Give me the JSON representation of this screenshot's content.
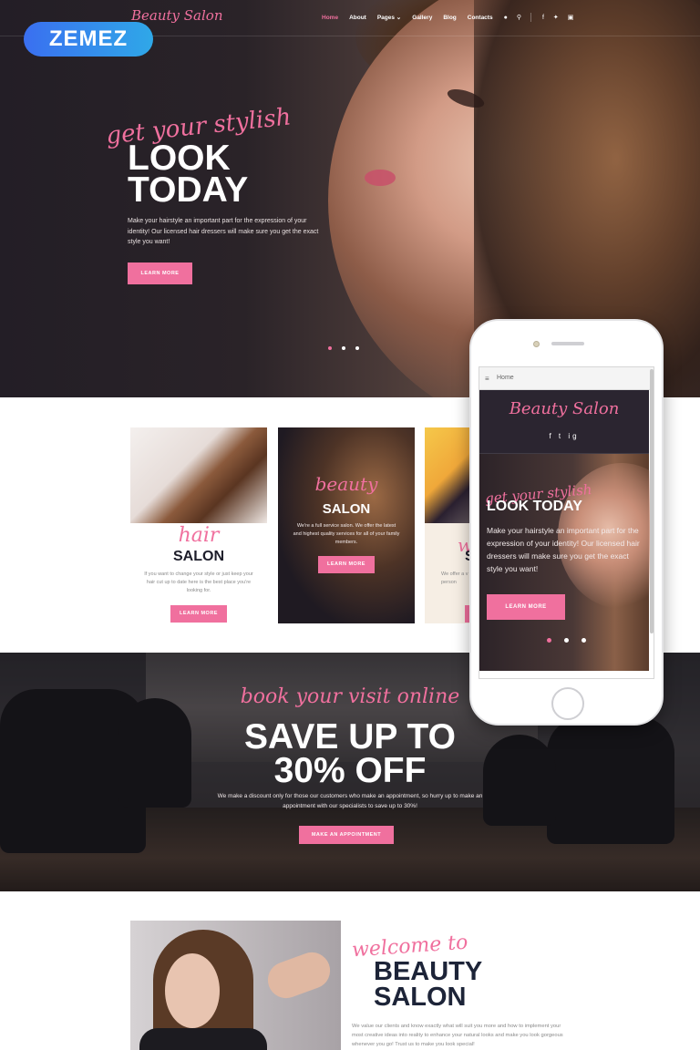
{
  "badge": {
    "label": "ZEMEZ"
  },
  "header": {
    "brand": "Beauty Salon",
    "nav": [
      {
        "label": "Home",
        "active": true
      },
      {
        "label": "About"
      },
      {
        "label": "Pages"
      },
      {
        "label": "Gallery"
      },
      {
        "label": "Blog"
      },
      {
        "label": "Contacts"
      }
    ],
    "icons": [
      "user-icon",
      "search-icon",
      "facebook-icon",
      "twitter-icon",
      "instagram-icon"
    ]
  },
  "hero": {
    "script": "get your stylish",
    "title_line1": "LOOK",
    "title_line2": "TODAY",
    "text": "Make your hairstyle an important part for the expression of your identity! Our licensed hair dressers will make sure you get the exact style you want!",
    "button": "LEARN MORE",
    "slides": 3,
    "active_slide": 1
  },
  "services": [
    {
      "script": "hair",
      "title": "SALON",
      "text": "If you want to change your style or just keep your hair cut up to date here is the best place you're looking for.",
      "button": "LEARN MORE"
    },
    {
      "script": "beauty",
      "title": "SALON",
      "text": "We're a full service salon. We offer the latest and highest quality services for all of your family members.",
      "button": "LEARN MORE"
    },
    {
      "script": "w",
      "title": "S",
      "text": "We offer a v on person",
      "button": "L"
    }
  ],
  "promo": {
    "script": "book your visit online",
    "title_line1": "SAVE UP TO",
    "title_line2": "30% OFF",
    "text": "We make a discount only for those our customers who make an appointment, so hurry up to make an appointment with our specialists to save up to 30%!",
    "button": "MAKE AN APPOINTMENT"
  },
  "welcome": {
    "script": "welcome to",
    "title_line1": "BEAUTY",
    "title_line2": "SALON",
    "text": "We value our clients and know exactly what will suit you more and how to implement your most creative ideas into reality to enhance your natural looks and make you look gorgeous whenever you go! Trust us to make you look special!"
  },
  "phone": {
    "bar_label": "Home",
    "brand": "Beauty Salon",
    "social": "f  t  ig",
    "script": "get your stylish",
    "title": "LOOK TODAY",
    "text": "Make your hairstyle an important part for the expression of your identity! Our licensed hair dressers will make sure you get the exact style you want!",
    "button": "LEARN MORE"
  },
  "colors": {
    "accent": "#f0709e",
    "dark": "#231e26",
    "heading": "#1d2438"
  }
}
